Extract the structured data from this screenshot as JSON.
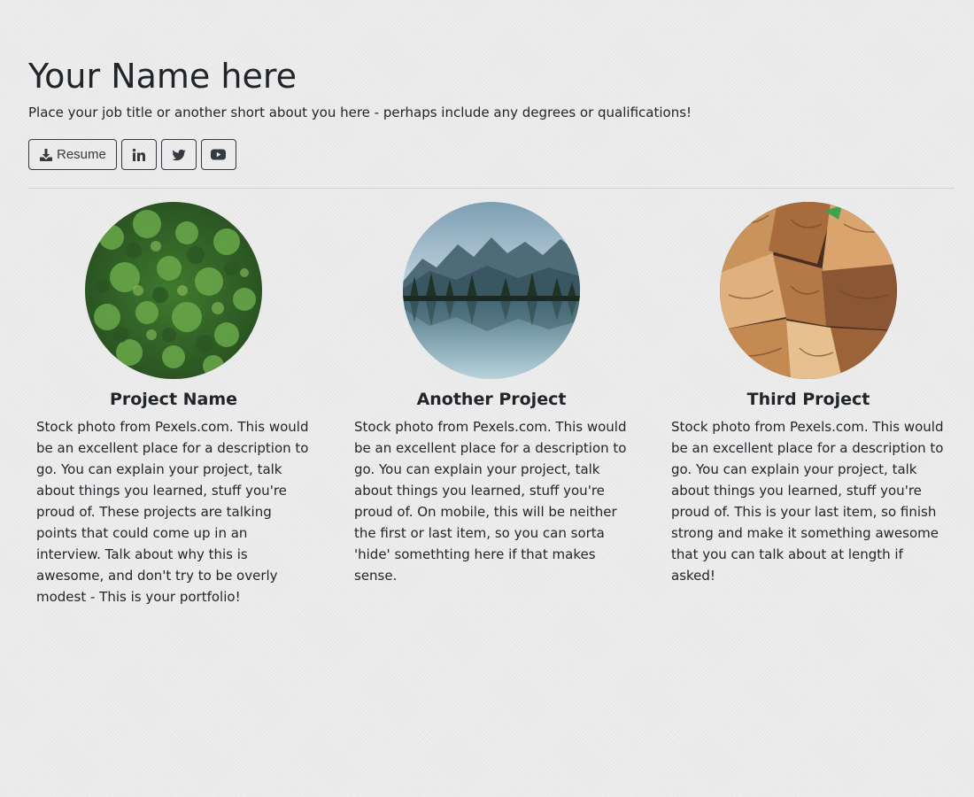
{
  "header": {
    "name": "Your Name here",
    "tagline": "Place your job title or another short about you here - perhaps include any degrees or qualifications!"
  },
  "buttons": [
    {
      "label": "Resume",
      "icon": "download-icon"
    },
    {
      "label": "",
      "icon": "linkedin-icon"
    },
    {
      "label": "",
      "icon": "twitter-icon"
    },
    {
      "label": "",
      "icon": "youtube-icon"
    }
  ],
  "projects": [
    {
      "title": "Project Name",
      "description": "Stock photo from Pexels.com. This would be an excellent place for a description to go. You can explain your project, talk about things you learned, stuff you're proud of. These projects are talking points that could come up in an interview. Talk about why this is awesome, and don't try to be overly modest - This is your portfolio!",
      "photo": "forest-aerial-photo"
    },
    {
      "title": "Another Project",
      "description": "Stock photo from Pexels.com. This would be an excellent place for a description to go. You can explain your project, talk about things you learned, stuff you're proud of. On mobile, this will be neither the first or last item, so you can sorta 'hide' somethting here if that makes sense.",
      "photo": "mountain-lake-photo"
    },
    {
      "title": "Third Project",
      "description": "Stock photo from Pexels.com. This would be an excellent place for a description to go. You can explain your project, talk about things you learned, stuff you're proud of. This is your last item, so finish strong and make it something awesome that you can talk about at length if asked!",
      "photo": "firewood-photo"
    }
  ],
  "colors": {
    "background": "#ebebeb",
    "text": "#212529",
    "button_border": "#343a40"
  }
}
